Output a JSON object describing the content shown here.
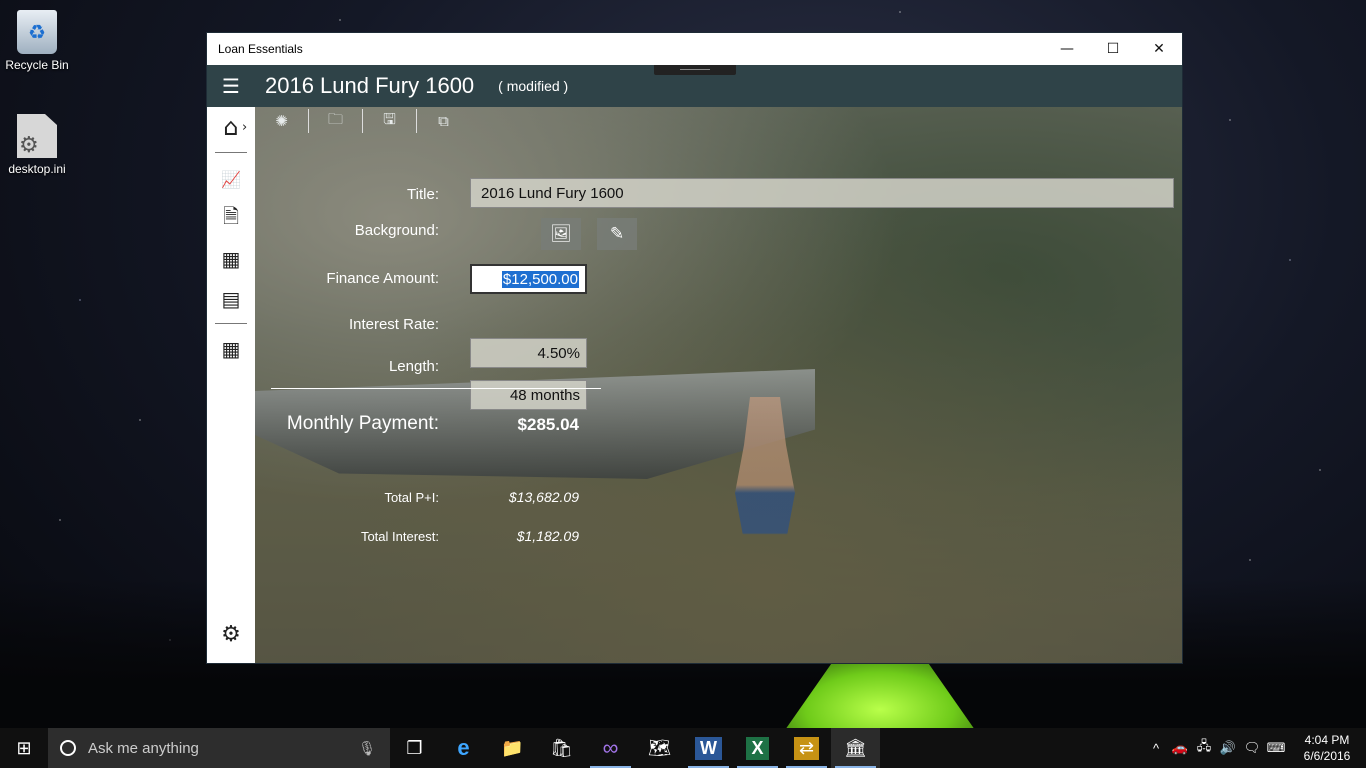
{
  "desktop": {
    "icons": [
      {
        "label": "Recycle Bin"
      },
      {
        "label": "desktop.ini"
      }
    ]
  },
  "window": {
    "app_title": "Loan Essentials",
    "controls": {
      "minimize": "—",
      "maximize": "☐",
      "close": "✕"
    }
  },
  "header": {
    "menu_icon": "☰",
    "doc_title": "2016 Lund Fury 1600",
    "status": "( modified )"
  },
  "nav": {
    "items": [
      {
        "icon": "home-icon",
        "glyph": "⌂"
      },
      {
        "icon": "chart-icon",
        "glyph": "📈"
      },
      {
        "icon": "search-doc-icon",
        "glyph": "🗎"
      },
      {
        "icon": "calendar-icon",
        "glyph": "▦"
      },
      {
        "icon": "schedule-icon",
        "glyph": "▤"
      },
      {
        "icon": "calculator-icon",
        "glyph": "▦"
      }
    ],
    "chevron": "›",
    "settings_glyph": "⚙"
  },
  "toolbar": {
    "buttons": [
      {
        "icon": "new-icon",
        "glyph": "✺"
      },
      {
        "icon": "open-folder-icon",
        "glyph": "🗀"
      },
      {
        "icon": "save-icon",
        "glyph": "🖫"
      },
      {
        "icon": "copy-icon",
        "glyph": "⧉"
      }
    ]
  },
  "form": {
    "title_label": "Title:",
    "title_value": "2016 Lund Fury 1600",
    "background_label": "Background:",
    "background_buttons": [
      {
        "icon": "image-icon",
        "glyph": "🖼"
      },
      {
        "icon": "brush-icon",
        "glyph": "✎"
      }
    ],
    "finance_label": "Finance Amount:",
    "finance_value": "$12,500.00",
    "rate_label": "Interest Rate:",
    "rate_value": "4.50%",
    "length_label": "Length:",
    "length_value": "48 months",
    "monthly_label": "Monthly Payment:",
    "monthly_value": "$285.04",
    "total_pi_label": "Total P+I:",
    "total_pi_value": "$13,682.09",
    "total_interest_label": "Total Interest:",
    "total_interest_value": "$1,182.09"
  },
  "taskbar": {
    "start_glyph": "⊞",
    "search_placeholder": "Ask me anything",
    "mic_glyph": "🎙",
    "apps": [
      {
        "name": "task-view-icon",
        "glyph": "❐"
      },
      {
        "name": "edge-icon",
        "glyph": "e"
      },
      {
        "name": "file-explorer-icon",
        "glyph": "📁"
      },
      {
        "name": "store-icon",
        "glyph": "🛍"
      },
      {
        "name": "visual-studio-icon",
        "glyph": "∞"
      },
      {
        "name": "maps-icon",
        "glyph": "🗺"
      },
      {
        "name": "word-icon",
        "glyph": "W"
      },
      {
        "name": "excel-icon",
        "glyph": "X"
      },
      {
        "name": "app-icon",
        "glyph": "⇄"
      },
      {
        "name": "loan-essentials-icon",
        "glyph": "🏛"
      }
    ],
    "tray": {
      "chevron": "^",
      "icons": [
        "🚗",
        "🖧",
        "🔊",
        "🗨",
        "⌨"
      ],
      "time": "4:04 PM",
      "date": "6/6/2016"
    }
  }
}
